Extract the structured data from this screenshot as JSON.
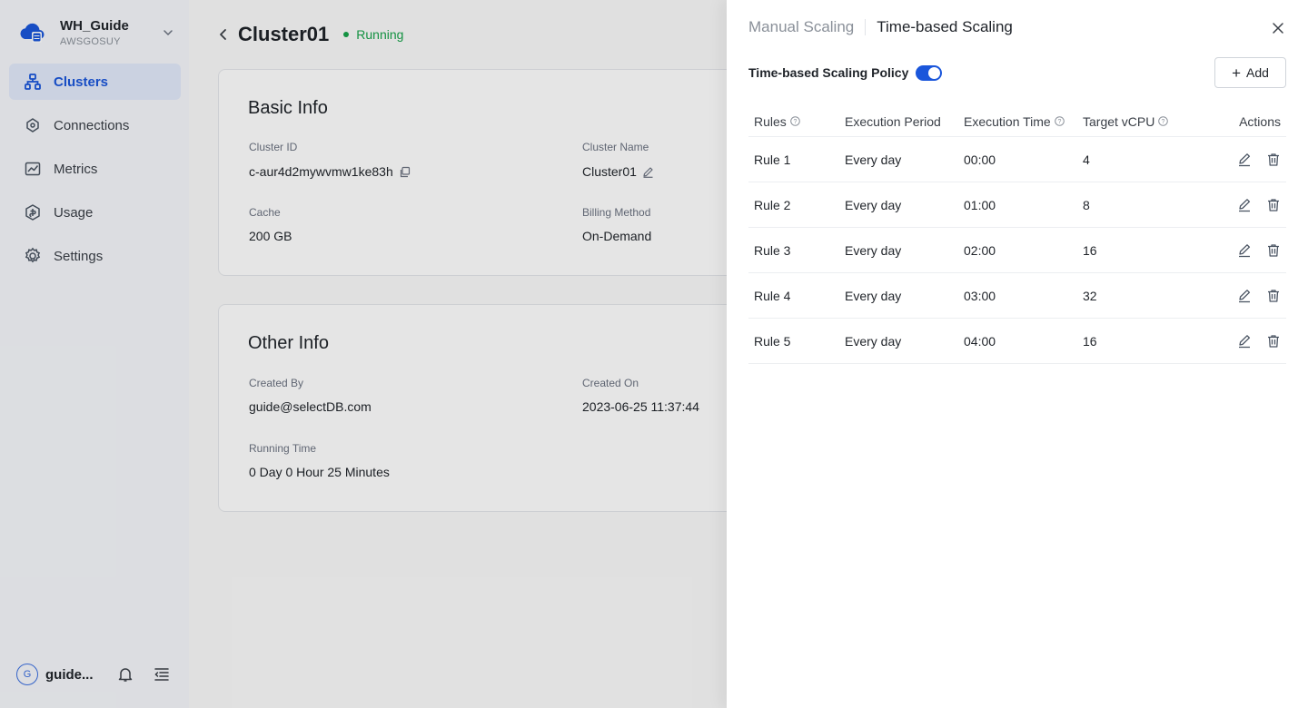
{
  "sidebar": {
    "workspace": {
      "name": "WH_Guide",
      "id": "AWSGOSUY"
    },
    "items": [
      {
        "label": "Clusters"
      },
      {
        "label": "Connections"
      },
      {
        "label": "Metrics"
      },
      {
        "label": "Usage"
      },
      {
        "label": "Settings"
      }
    ],
    "user": {
      "initial": "G",
      "name": "guide..."
    }
  },
  "header": {
    "title": "Cluster01",
    "status": "Running"
  },
  "basic_info": {
    "title": "Basic Info",
    "cluster_id_label": "Cluster ID",
    "cluster_id": "c-aur4d2mywvmw1ke83h",
    "cluster_name_label": "Cluster Name",
    "cluster_name": "Cluster01",
    "cache_label": "Cache",
    "cache": "200 GB",
    "billing_label": "Billing Method",
    "billing": "On-Demand"
  },
  "other_info": {
    "title": "Other Info",
    "created_by_label": "Created By",
    "created_by": "guide@selectDB.com",
    "created_on_label": "Created On",
    "created_on": "2023-06-25 11:37:44",
    "running_time_label": "Running Time",
    "running_time": "0 Day 0 Hour 25 Minutes"
  },
  "drawer": {
    "tabs": [
      {
        "label": "Manual Scaling"
      },
      {
        "label": "Time-based Scaling"
      }
    ],
    "policy_label": "Time-based Scaling Policy",
    "policy_enabled": true,
    "add_label": "Add",
    "columns": {
      "rules": "Rules",
      "period": "Execution Period",
      "time": "Execution Time",
      "vcpu": "Target vCPU",
      "actions": "Actions"
    },
    "rows": [
      {
        "rule": "Rule 1",
        "period": "Every day",
        "time": "00:00",
        "vcpu": "4"
      },
      {
        "rule": "Rule 2",
        "period": "Every day",
        "time": "01:00",
        "vcpu": "8"
      },
      {
        "rule": "Rule 3",
        "period": "Every day",
        "time": "02:00",
        "vcpu": "16"
      },
      {
        "rule": "Rule 4",
        "period": "Every day",
        "time": "03:00",
        "vcpu": "32"
      },
      {
        "rule": "Rule 5",
        "period": "Every day",
        "time": "04:00",
        "vcpu": "16"
      }
    ]
  },
  "colors": {
    "accent": "#1a56db",
    "running": "#17a34a"
  }
}
